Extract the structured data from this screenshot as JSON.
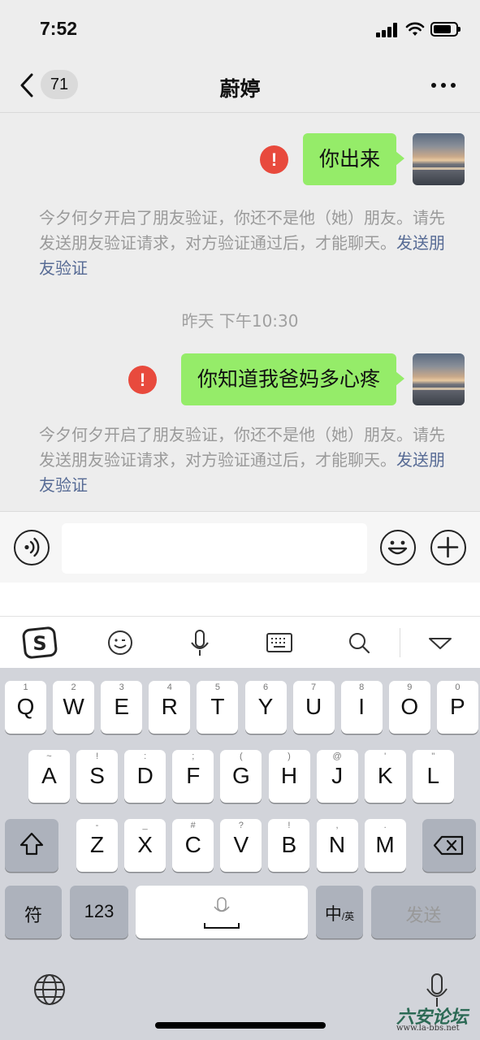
{
  "status_bar": {
    "time": "7:52",
    "battery_level": 0.8
  },
  "nav": {
    "unread_count": "71",
    "title": "蔚婷"
  },
  "messages": [
    {
      "text": "你出来",
      "status": "failed"
    },
    {
      "text": "你知道我爸妈多心疼",
      "status": "failed"
    }
  ],
  "system_notes": [
    {
      "text": "今夕何夕开启了朋友验证，你还不是他（她）朋友。请先发送朋友验证请求，对方验证通过后，才能聊天。",
      "link": "发送朋友验证"
    },
    {
      "text": "今夕何夕开启了朋友验证，你还不是他（她）朋友。请先发送朋友验证请求，对方验证通过后，才能聊天。",
      "link": "发送朋友验证"
    }
  ],
  "timestamp": "昨天 下午10:30",
  "input": {
    "value": "",
    "placeholder": ""
  },
  "error_icon": "!",
  "keyboard": {
    "row1": [
      {
        "main": "Q",
        "sub": "1"
      },
      {
        "main": "W",
        "sub": "2"
      },
      {
        "main": "E",
        "sub": "3"
      },
      {
        "main": "R",
        "sub": "4"
      },
      {
        "main": "T",
        "sub": "5"
      },
      {
        "main": "Y",
        "sub": "6"
      },
      {
        "main": "U",
        "sub": "7"
      },
      {
        "main": "I",
        "sub": "8"
      },
      {
        "main": "O",
        "sub": "9"
      },
      {
        "main": "P",
        "sub": "0"
      }
    ],
    "row2": [
      {
        "main": "A",
        "sub": "~"
      },
      {
        "main": "S",
        "sub": "!"
      },
      {
        "main": "D",
        "sub": ":"
      },
      {
        "main": "F",
        "sub": ";"
      },
      {
        "main": "G",
        "sub": "("
      },
      {
        "main": "H",
        "sub": ")"
      },
      {
        "main": "J",
        "sub": "@"
      },
      {
        "main": "K",
        "sub": "'"
      },
      {
        "main": "L",
        "sub": "\""
      }
    ],
    "row3": [
      {
        "main": "Z",
        "sub": "-"
      },
      {
        "main": "X",
        "sub": "_"
      },
      {
        "main": "C",
        "sub": "#"
      },
      {
        "main": "V",
        "sub": "?"
      },
      {
        "main": "B",
        "sub": "!"
      },
      {
        "main": "N",
        "sub": ","
      },
      {
        "main": "M",
        "sub": "."
      }
    ],
    "symbols_label": "符",
    "numbers_label": "123",
    "lang_label": "中",
    "lang_sub": "/英",
    "send_label": "发送"
  },
  "watermark": {
    "title": "六安论坛",
    "url": "www.la-bbs.net"
  },
  "icons": {
    "back": "chevron-left-icon",
    "more": "more-icon",
    "error": "error-icon",
    "voice": "voice-icon",
    "emoji": "emoji-icon",
    "plus": "plus-icon",
    "sogou": "sogou-logo-icon",
    "face": "smiley-icon",
    "mic": "microphone-icon",
    "keyboard": "keyboard-icon",
    "search": "search-icon",
    "collapse": "triangle-down-icon",
    "shift": "shift-icon",
    "delete": "backspace-icon",
    "globe": "globe-icon"
  },
  "colors": {
    "bubble": "#95ec69",
    "error": "#e84a3d",
    "link": "#576b95",
    "background": "#ededed"
  }
}
